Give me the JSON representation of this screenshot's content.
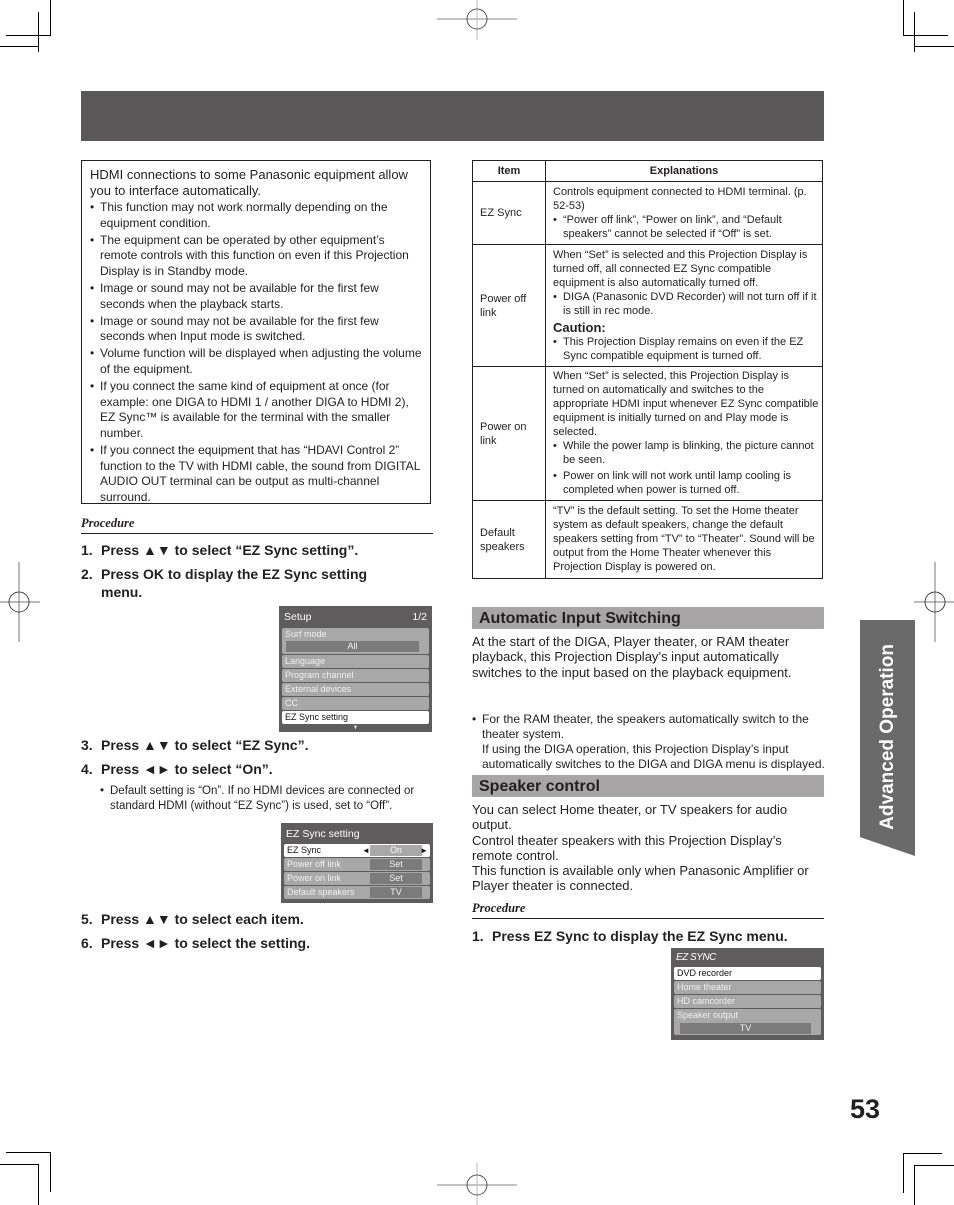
{
  "page": {
    "number": "53",
    "side_tab": "Advanced Operation",
    "colors": {
      "header_bar": "#5a5859",
      "section_bar": "#a7a5a6",
      "side_tab": "#6b6a6b",
      "osd_bg": "#5e5c5d"
    }
  },
  "notes": {
    "intro": "HDMI connections to some Panasonic equipment allow you to interface automatically.",
    "items": [
      "This function may not work normally depending on the equipment condition.",
      "The equipment can be operated by other equipment’s remote controls with this function on even if this Projection Display is in Standby mode.",
      "Image or sound may not be available for the first few seconds when the playback starts.",
      "Image or sound may not be available for the first few seconds when Input mode is switched.",
      "Volume function will be displayed when adjusting the volume of the equipment.",
      "If you connect the same kind of equipment at once (for example: one DIGA to HDMI 1 / another DIGA to HDMI 2), EZ Sync™ is available for the terminal with the smaller number.",
      "If you connect the equipment that has “HDAVI Control 2” function to the TV with HDMI cable, the sound from DIGITAL AUDIO OUT terminal can be output as multi-channel surround."
    ]
  },
  "left_procedure": {
    "label": "Procedure",
    "steps": [
      {
        "num": "1.",
        "text": "Press ▲▼ to select “EZ Sync setting”."
      },
      {
        "num": "2.",
        "text": "Press OK to display the EZ Sync setting menu."
      },
      {
        "num": "3.",
        "text": "Press ▲▼ to select “EZ Sync”."
      },
      {
        "num": "4.",
        "text": "Press ◄► to select “On”."
      },
      {
        "num": "5.",
        "text": "Press ▲▼ to select each item."
      },
      {
        "num": "6.",
        "text": "Press ◄► to select the setting."
      }
    ],
    "step4_note": "Default setting is “On”. If no HDMI devices are connected or standard HDMI (without “EZ Sync”) is used, set to “Off”."
  },
  "setup_menu": {
    "title": "Setup",
    "page": "1/2",
    "items": [
      {
        "label": "Surf mode",
        "value": "All"
      },
      {
        "label": "Language"
      },
      {
        "label": "Program channel"
      },
      {
        "label": "External devices"
      },
      {
        "label": "CC"
      },
      {
        "label": "EZ Sync setting",
        "selected": true
      }
    ],
    "more_indicator": "▼"
  },
  "ez_sync_setting_menu": {
    "title": "EZ Sync setting",
    "items": [
      {
        "label": "EZ Sync",
        "value": "On",
        "selected": true,
        "left_arrow": "◄",
        "right_arrow": "►"
      },
      {
        "label": "Power off link",
        "value": "Set"
      },
      {
        "label": "Power on link",
        "value": "Set"
      },
      {
        "label": "Default speakers",
        "value": "TV"
      }
    ]
  },
  "table": {
    "headers": [
      "Item",
      "Explanations"
    ],
    "rows": [
      {
        "item": "EZ Sync",
        "text": "Controls equipment connected to HDMI terminal. (p. 52-53)",
        "bullets": [
          "“Power off link”, “Power on link”, and “Default speakers” cannot be selected if “Off” is set."
        ]
      },
      {
        "item": "Power off link",
        "text": "When “Set” is selected and this Projection Display is turned off, all connected EZ Sync compatible equipment is also automatically turned off.",
        "bullets": [
          "DIGA (Panasonic DVD Recorder) will not turn off if it is still in rec mode."
        ],
        "caution_label": "Caution:",
        "caution_bullets": [
          "This Projection Display remains on even if the EZ Sync compatible equipment is turned off."
        ]
      },
      {
        "item": "Power on link",
        "text": "When “Set” is selected, this Projection Display is turned on automatically and switches to the appropriate HDMI input whenever EZ Sync compatible equipment is initially turned on and Play mode is selected.",
        "bullets": [
          "While the power lamp is blinking, the picture cannot be seen.",
          "Power on link will not work until lamp cooling is completed when power is turned off."
        ]
      },
      {
        "item": "Default speakers",
        "text": "“TV” is the default setting. To set the Home theater system as default speakers, change the default speakers setting from “TV” to “Theater”. Sound will be output from the Home Theater whenever this Projection Display is powered on.",
        "bullets": []
      }
    ]
  },
  "auto_input": {
    "title": "Automatic Input Switching",
    "body": "At the start of the DIGA, Player theater, or RAM theater playback, this Projection Display’s input automatically switches to the input based on the playback equipment.",
    "bullet": "For the RAM theater, the speakers automatically switch to the theater system.",
    "bullet_cont": "If using the DIGA operation, this Projection Display’s input automatically switches to the DIGA and DIGA menu is displayed."
  },
  "speaker_control": {
    "title": "Speaker control",
    "lines": [
      "You can select Home theater, or TV speakers for audio output.",
      "Control theater speakers with this Projection Display’s remote control.",
      "This function is available only when Panasonic Amplifier or Player theater is connected."
    ],
    "procedure_label": "Procedure",
    "step": {
      "num": "1.",
      "text": "Press EZ Sync to display the EZ Sync menu."
    }
  },
  "ez_sync_menu": {
    "logo": "EZ SYNC",
    "items": [
      {
        "label": "DVD recorder",
        "selected": true
      },
      {
        "label": "Home theater"
      },
      {
        "label": "HD camcorder"
      },
      {
        "label": "Speaker output",
        "value": "TV"
      }
    ]
  }
}
